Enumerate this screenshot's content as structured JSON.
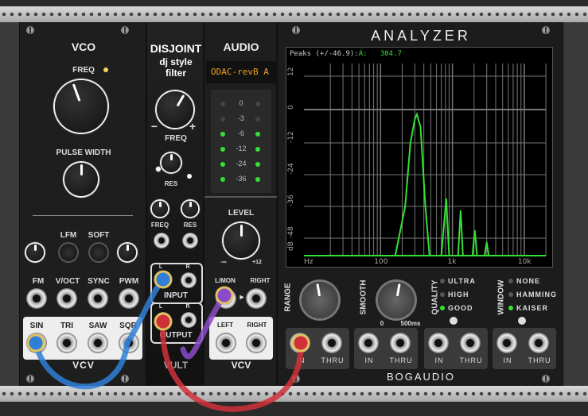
{
  "vco": {
    "title": "VCO",
    "freq_label": "FREQ",
    "pulse_width_label": "PULSE WIDTH",
    "lfm_label": "LFM",
    "soft_label": "SOFT",
    "inputs": [
      "FM",
      "V/OCT",
      "SYNC",
      "PWM"
    ],
    "outputs": [
      "SIN",
      "TRI",
      "SAW",
      "SQR"
    ],
    "brand": "VCV"
  },
  "disjoint": {
    "title": "DISJOINT",
    "subtitle1": "dj style",
    "subtitle2": "filter",
    "freq_label": "FREQ",
    "res_label": "RES",
    "cv_freq_label": "FREQ",
    "cv_res_label": "RES",
    "minus": "−",
    "plus": "+",
    "input_label": "INPUT",
    "output_label": "OUTPUT",
    "l": "L",
    "r": "R",
    "brand": "VULT"
  },
  "audio": {
    "title": "AUDIO",
    "device": "ODAC-revB A",
    "meter_labels": [
      "0",
      "-3",
      "-6",
      "-12",
      "-24",
      "-36"
    ],
    "level_label": "LEVEL",
    "level_min": "-∞",
    "level_max": "+12",
    "lmon_label": "L/MON",
    "right_label": "RIGHT",
    "left_label": "LEFT",
    "right2_label": "RIGHT",
    "brand": "VCV"
  },
  "analyzer": {
    "title": "ANALYZER",
    "peaks_label": "Peaks (+/-46.9):",
    "channel": "A:",
    "peak_value": "304.7",
    "y_labels": [
      "12",
      "0",
      "-12",
      "-24",
      "-36",
      "-48",
      "dB"
    ],
    "x_labels": [
      "Hz",
      "100",
      "1k",
      "10k"
    ],
    "range_label": "RANGE",
    "smooth_label": "SMOOTH",
    "smooth_min": "0",
    "smooth_max": "500ms",
    "quality_label": "QUALITY",
    "quality_options": [
      "ULTRA",
      "HIGH",
      "GOOD"
    ],
    "window_label": "WINDOW",
    "window_options": [
      "NONE",
      "HAMMING",
      "KAISER"
    ],
    "in_label": "IN",
    "thru_label": "THRU",
    "brand": "BOGAUDIO"
  },
  "colors": {
    "green": "#35e035",
    "blue_cable": "#2f7fd8",
    "red_cable": "#d0303a",
    "purple_cable": "#8a4bc8",
    "led_yellow": "#f5d35a"
  }
}
